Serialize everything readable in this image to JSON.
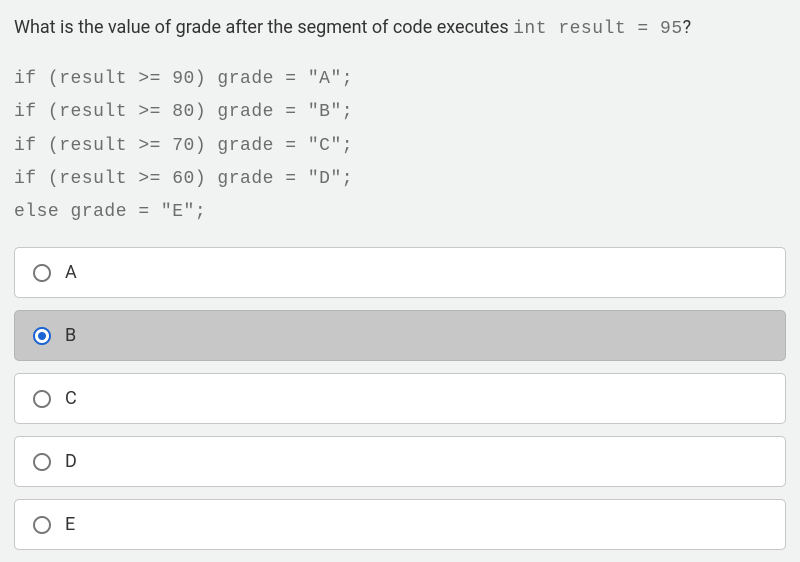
{
  "question": {
    "prefix": "What is the value of grade after the segment of code executes ",
    "code_inline": "int result = 95",
    "suffix": "?"
  },
  "code_lines": [
    "if (result >= 90) grade = \"A\";",
    "if (result >= 80) grade = \"B\";",
    "if (result >= 70) grade = \"C\";",
    "if (result >= 60) grade = \"D\";",
    "else grade = \"E\";"
  ],
  "options": [
    {
      "label": "A",
      "selected": false
    },
    {
      "label": "B",
      "selected": true
    },
    {
      "label": "C",
      "selected": false
    },
    {
      "label": "D",
      "selected": false
    },
    {
      "label": "E",
      "selected": false
    }
  ]
}
